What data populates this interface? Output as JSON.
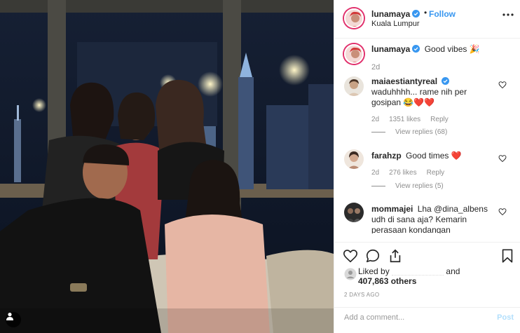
{
  "post": {
    "author": {
      "username": "lunamaya",
      "verified": true,
      "location": "Kuala Lumpur",
      "follow_label": "Follow",
      "separator": "•"
    },
    "caption": {
      "username": "lunamaya",
      "text": "Good vibes 🎉",
      "time": "2d"
    },
    "comments": [
      {
        "username": "maiaestiantyreal",
        "verified": true,
        "text": "waduhhhh... rame nih per gosipan 😂❤️❤️",
        "time": "2d",
        "likes": "1351 likes",
        "reply_label": "Reply",
        "view_replies": "View replies (68)"
      },
      {
        "username": "farahzp",
        "verified": false,
        "text": "Good times ❤️",
        "time": "2d",
        "likes": "276 likes",
        "reply_label": "Reply",
        "view_replies": "View replies (5)"
      },
      {
        "username": "mommajei",
        "verified": false,
        "text": "Lha @dina_albens udh di sana aja? Kemarin perasaan kondangan",
        "time": "",
        "likes": "",
        "reply_label": "",
        "view_replies": ""
      }
    ],
    "actions": {
      "icons": [
        "heart-icon",
        "comment-icon",
        "share-icon",
        "bookmark-icon"
      ]
    },
    "likes": {
      "prefix": "Liked by",
      "conjunction": "and",
      "count": "407,863 others"
    },
    "timestamp": "2 DAYS AGO",
    "add_comment": {
      "placeholder": "Add a comment...",
      "post_label": "Post"
    }
  },
  "colors": {
    "link_blue": "#3897f0",
    "post_disabled": "#b2dffc",
    "secondary_text": "#8e8e8e",
    "heart_red": "#ed4956",
    "verified_blue": "#3897f0"
  }
}
